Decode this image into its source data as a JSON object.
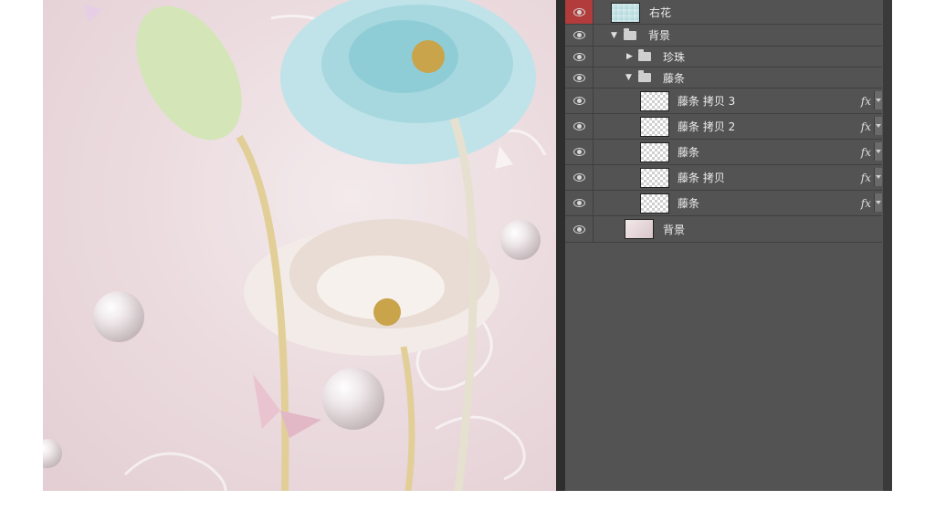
{
  "layers": [
    {
      "name": "右花",
      "indent": 0,
      "kind": "layer",
      "selected": true,
      "fx": false,
      "thumb": "flower"
    },
    {
      "name": "背景",
      "indent": 0,
      "kind": "group",
      "expanded": true
    },
    {
      "name": "珍珠",
      "indent": 1,
      "kind": "group",
      "expanded": false
    },
    {
      "name": "藤条",
      "indent": 1,
      "kind": "group",
      "expanded": true
    },
    {
      "name": "藤条 拷贝 3",
      "indent": 2,
      "kind": "layer",
      "fx": true,
      "thumb": "transparent"
    },
    {
      "name": "藤条 拷贝 2",
      "indent": 2,
      "kind": "layer",
      "fx": true,
      "thumb": "transparent"
    },
    {
      "name": "藤条",
      "indent": 2,
      "kind": "layer",
      "fx": true,
      "thumb": "transparent"
    },
    {
      "name": "藤条 拷贝",
      "indent": 2,
      "kind": "layer",
      "fx": true,
      "thumb": "transparent"
    },
    {
      "name": "藤条",
      "indent": 2,
      "kind": "layer",
      "fx": true,
      "thumb": "transparent"
    },
    {
      "name": "背景",
      "indent": 1,
      "kind": "layer",
      "fx": false,
      "thumb": "background"
    }
  ],
  "fx_label": "fx",
  "icons": {
    "visibility": "eye-icon",
    "group": "folder-icon",
    "expanded": "caret-down-icon",
    "collapsed": "caret-right-icon"
  },
  "colors": {
    "panel": "#535353",
    "selected_eye": "#b23b3b",
    "canvas": "#ead9dd"
  }
}
